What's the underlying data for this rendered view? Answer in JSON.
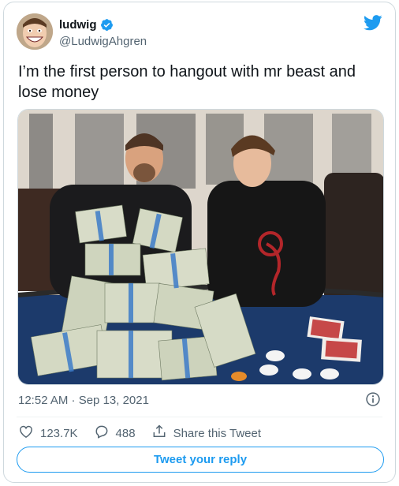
{
  "user": {
    "display_name": "ludwig",
    "handle": "@LudwigAhgren",
    "verified": true,
    "avatar_icon": "avatar"
  },
  "tweet": {
    "text": "I’m the first person to hangout with mr beast and lose money",
    "photo_description_icon": "photo"
  },
  "meta": {
    "timestamp": "12:52 AM · Sep 13, 2021"
  },
  "actions": {
    "likes": "123.7K",
    "replies": "488",
    "share_label": "Share this Tweet"
  },
  "reply_button": {
    "label": "Tweet your reply"
  },
  "colors": {
    "accent": "#1d9bf0",
    "text_primary": "#0f1419",
    "text_secondary": "#536471",
    "border": "#cfd9de"
  },
  "icons": [
    "twitter-bird-icon",
    "verified-badge-icon",
    "info-icon",
    "like-icon",
    "reply-icon",
    "share-icon"
  ]
}
